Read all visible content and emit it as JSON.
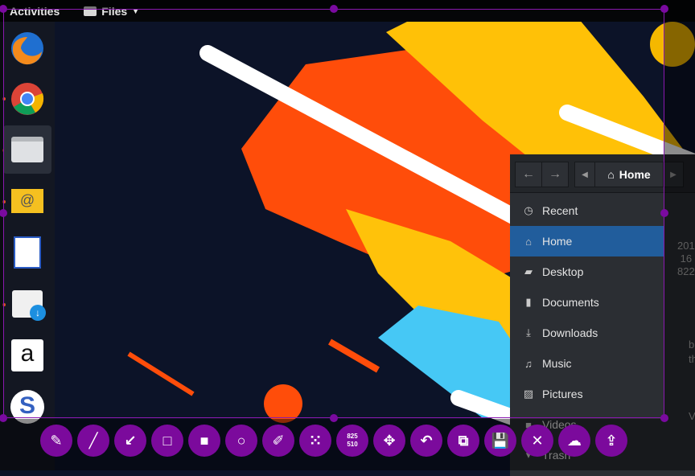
{
  "topbar": {
    "activities": "Activities",
    "app_menu": "Files"
  },
  "dock": {
    "apps": [
      "firefox",
      "chrome",
      "files",
      "mail",
      "writer",
      "software",
      "amazon",
      "simplenote"
    ]
  },
  "files_window": {
    "location": "Home",
    "sidebar": [
      {
        "label": "Recent",
        "icon": "clock-icon"
      },
      {
        "label": "Home",
        "icon": "home-icon",
        "selected": true
      },
      {
        "label": "Desktop",
        "icon": "desktop-icon"
      },
      {
        "label": "Documents",
        "icon": "document-icon"
      },
      {
        "label": "Downloads",
        "icon": "download-icon"
      },
      {
        "label": "Music",
        "icon": "music-icon"
      },
      {
        "label": "Pictures",
        "icon": "picture-icon"
      },
      {
        "label": "Videos",
        "icon": "video-icon"
      },
      {
        "label": "Trash",
        "icon": "trash-icon"
      }
    ],
    "partial_text": [
      "201",
      "16",
      "822",
      "b",
      "th",
      "V"
    ]
  },
  "screenshot_tool": {
    "accent": "#7b0a9c",
    "selection_size": {
      "w": "825",
      "h": "510"
    },
    "buttons": [
      "pencil",
      "line",
      "arrow",
      "rectangle",
      "filled-rectangle",
      "circle",
      "marker",
      "blur",
      "size",
      "move",
      "undo",
      "copy",
      "save",
      "close",
      "upload",
      "open-app"
    ]
  }
}
